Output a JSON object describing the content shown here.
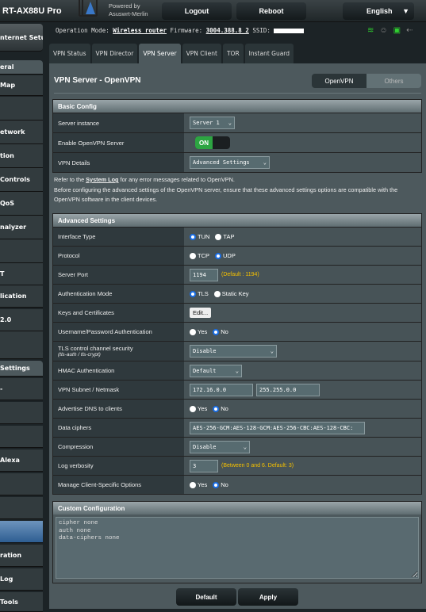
{
  "header": {
    "model": "RT-AX88U Pro",
    "powered_by": "Powered by",
    "firmware_brand": "Asuswrt-Merlin",
    "logout": "Logout",
    "reboot": "Reboot",
    "language": "English"
  },
  "sidebar": {
    "items": [
      "nternet Setup",
      "eral",
      "Map",
      "",
      "etwork",
      "tion",
      " Controls",
      " QoS",
      "nalyzer",
      "",
      "T",
      "lication",
      "2.0",
      "",
      " Settings",
      "-",
      "",
      "",
      "Alexa",
      "",
      "",
      "",
      "ration",
      "Log",
      " Tools"
    ]
  },
  "info": {
    "op_mode_label": "Operation Mode:",
    "op_mode": "Wireless router",
    "fw_label": "Firmware:",
    "firmware": "3004.388.8_2",
    "ssid_label": "SSID:"
  },
  "tabs": [
    "VPN Status",
    "VPN Director",
    "VPN Server",
    "VPN Client",
    "TOR",
    "Instant Guard"
  ],
  "page": {
    "title": "VPN Server - OpenVPN",
    "seg": [
      "OpenVPN",
      "Others"
    ]
  },
  "basic": {
    "title": "Basic Config",
    "server_instance_label": "Server instance",
    "server_instance": "Server 1",
    "enable_label": "Enable OpenVPN Server",
    "enable": "ON",
    "details_label": "VPN Details",
    "details": "Advanced Settings"
  },
  "note": {
    "pre": "Refer to the ",
    "link": "System Log",
    "post": " for any error messages related to OpenVPN.",
    "line2": "Before configuring the advanced settings of the OpenVPN server, ensure that these advanced settings options are compatible with the OpenVPN software in the client devices."
  },
  "adv": {
    "title": "Advanced Settings",
    "iface_label": "Interface Type",
    "tun": "TUN",
    "tap": "TAP",
    "proto_label": "Protocol",
    "tcp": "TCP",
    "udp": "UDP",
    "port_label": "Server Port",
    "port": "1194",
    "port_hint": "(Default : 1194)",
    "auth_label": "Authentication Mode",
    "tls": "TLS",
    "static": "Static Key",
    "keys_label": "Keys and Certificates",
    "edit": "Edit...",
    "userpass_label": "Username/Password Authentication",
    "yes": "Yes",
    "no": "No",
    "tlsc_label": "TLS control channel security",
    "tlsc_sub": "(tls-auth / tls-crypt)",
    "tlsc": "Disable",
    "hmac_label": "HMAC Authentication",
    "hmac": "Default",
    "subnet_label": "VPN Subnet / Netmask",
    "subnet": "172.16.0.0",
    "netmask": "255.255.0.0",
    "dns_label": "Advertise DNS to clients",
    "ciphers_label": "Data ciphers",
    "ciphers": "AES-256-GCM:AES-128-GCM:AES-256-CBC:AES-128-CBC:",
    "comp_label": "Compression",
    "comp": "Disable",
    "verb_label": "Log verbosity",
    "verb": "3",
    "verb_hint": "(Between 0 and 6. Default: 3)",
    "ccs_label": "Manage Client-Specific Options"
  },
  "custom": {
    "title": "Custom Configuration",
    "text": "cipher none\nauth none\ndata-ciphers none"
  },
  "buttons": {
    "default": "Default",
    "apply": "Apply"
  },
  "colors": {
    "accent": "#2da542",
    "hint": "#f5c000",
    "radio": "#1a6ee6"
  }
}
